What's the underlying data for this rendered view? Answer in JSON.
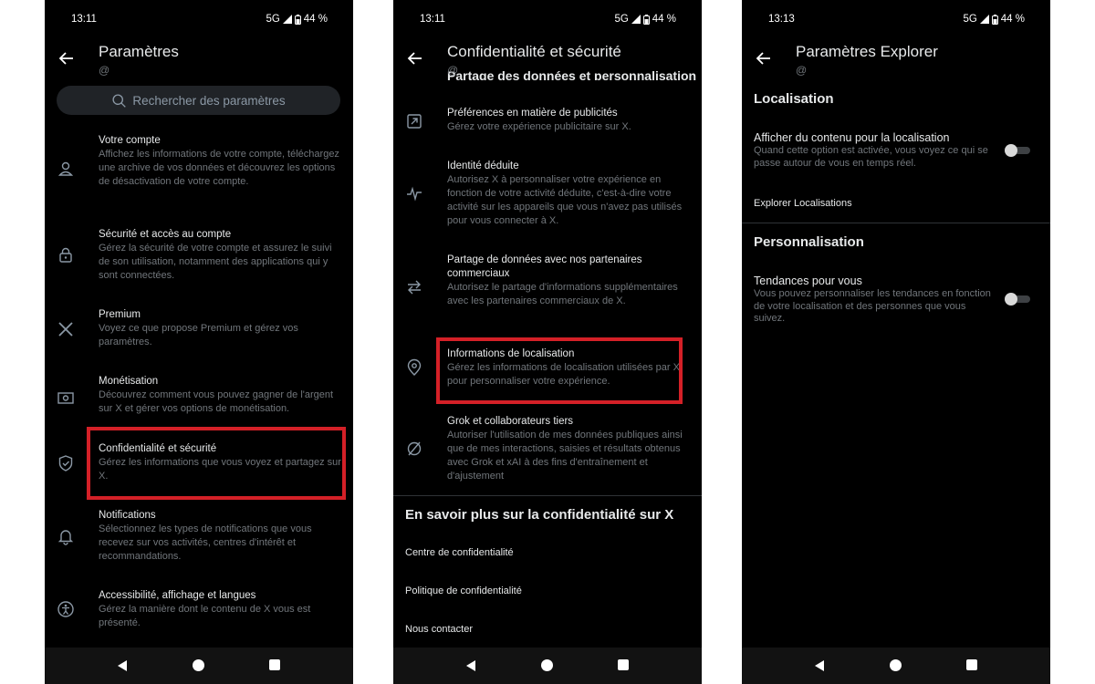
{
  "statusbar": {
    "time1": "13:11",
    "time2": "13:11",
    "time3": "13:13",
    "network": "5G",
    "battery": "44 %"
  },
  "screen1": {
    "title": "Paramètres",
    "subtitle": "@",
    "search_placeholder": "Rechercher des paramètres",
    "items": [
      {
        "title": "Votre compte",
        "desc": "Affichez les informations de votre compte, téléchargez une archive de vos données et découvrez les options de désactivation de votre compte.",
        "icon": "user-icon"
      },
      {
        "title": "Sécurité et accès au compte",
        "desc": "Gérez la sécurité de votre compte et assurez le suivi de son utilisation, notamment des applications qui y sont connectées.",
        "icon": "lock-icon"
      },
      {
        "title": "Premium",
        "desc": "Voyez ce que propose Premium et gérez vos paramètres.",
        "icon": "x-logo-icon"
      },
      {
        "title": "Monétisation",
        "desc": "Découvrez comment vous pouvez gagner de l'argent sur X et gérer vos options de monétisation.",
        "icon": "money-icon"
      },
      {
        "title": "Confidentialité et sécurité",
        "desc": "Gérez les informations que vous voyez et partagez sur X.",
        "icon": "shield-icon"
      },
      {
        "title": "Notifications",
        "desc": "Sélectionnez les types de notifications que vous recevez sur vos activités, centres d'intérêt et recommandations.",
        "icon": "bell-icon"
      },
      {
        "title": "Accessibilité, affichage et langues",
        "desc": "Gérez la manière dont le contenu de X vous est présenté.",
        "icon": "accessibility-icon"
      }
    ]
  },
  "screen2": {
    "title": "Confidentialité et sécurité",
    "subtitle": "@",
    "cut_heading": "Partage des données et personnalisation",
    "items": [
      {
        "title": "Préférences en matière de publicités",
        "desc": "Gérez votre expérience publicitaire sur X.",
        "icon": "ad-icon"
      },
      {
        "title": "Identité déduite",
        "desc": "Autorisez X à personnaliser votre expérience en fonction de votre activité déduite, c'est-à-dire votre activité sur les appareils que vous n'avez pas utilisés pour vous connecter à X.",
        "icon": "activity-icon"
      },
      {
        "title": "Partage de données avec nos partenaires commerciaux",
        "desc": "Autorisez le partage d'informations supplémentaires avec les partenaires commerciaux de X.",
        "icon": "swap-icon"
      },
      {
        "title": "Informations de localisation",
        "desc": "Gérez les informations de localisation utilisées par X pour personnaliser votre expérience.",
        "icon": "location-pin-icon"
      },
      {
        "title": "Grok et collaborateurs tiers",
        "desc": "Autoriser l'utilisation de mes données publiques ainsi que de mes interactions, saisies et résultats obtenus avec Grok et xAI à des fins d'entraînement et d'ajustement",
        "icon": "grok-icon"
      }
    ],
    "learn_more": "En savoir plus sur la confidentialité sur X",
    "links": [
      "Centre de confidentialité",
      "Politique de confidentialité",
      "Nous contacter"
    ]
  },
  "screen3": {
    "title": "Paramètres Explorer",
    "subtitle": "@",
    "section1": "Localisation",
    "location_toggle_title": "Afficher du contenu pour la localisation",
    "location_toggle_desc": "Quand cette option est activée, vous voyez ce qui se passe autour de vous en temps réel.",
    "explore_locations": "Explorer Localisations",
    "section2": "Personnalisation",
    "trends_title": "Tendances pour vous",
    "trends_desc": "Vous pouvez personnaliser les tendances en fonction de votre localisation et des personnes que vous suivez."
  },
  "colors": {
    "background": "#000000",
    "text": "#e7e9ea",
    "secondary_text": "#71767b",
    "highlight": "#d42027",
    "search_bg": "#202327"
  }
}
